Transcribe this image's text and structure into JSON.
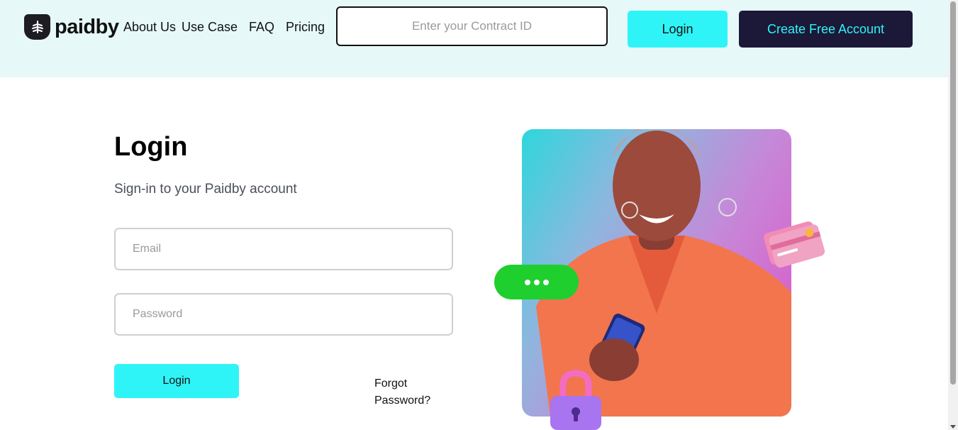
{
  "brand": {
    "name": "paidby",
    "logo_icon": "tree-shield-icon"
  },
  "nav": {
    "items": [
      {
        "label": "About Us"
      },
      {
        "label": "Use Case"
      },
      {
        "label": "FAQ"
      },
      {
        "label": "Pricing"
      }
    ]
  },
  "header": {
    "contract_placeholder": "Enter your Contract ID",
    "login_label": "Login",
    "create_account_label": "Create Free Account"
  },
  "login": {
    "title": "Login",
    "subtitle": "Sign-in to your Paidby account",
    "email_placeholder": "Email",
    "password_placeholder": "Password",
    "submit_label": "Login",
    "forgot_label": "Forgot Password?"
  },
  "illustration": {
    "icons": [
      "chat-bubble-icon",
      "credit-card-icon",
      "padlock-icon"
    ]
  },
  "colors": {
    "accent": "#2ff4f7",
    "dark": "#1b1838",
    "header_bg": "#e6f8f8",
    "chat_green": "#1fcf2d"
  }
}
